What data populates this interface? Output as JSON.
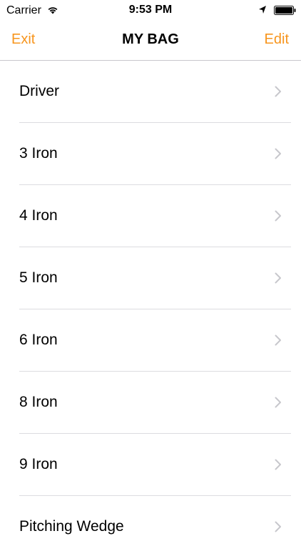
{
  "status_bar": {
    "carrier": "Carrier",
    "time": "9:53 PM",
    "icons": [
      "wifi-icon",
      "location-icon",
      "battery-icon"
    ]
  },
  "nav": {
    "left_label": "Exit",
    "title": "MY BAG",
    "right_label": "Edit",
    "accent_color": "#f7951d"
  },
  "clubs": [
    {
      "label": "Driver"
    },
    {
      "label": "3 Iron"
    },
    {
      "label": "4 Iron"
    },
    {
      "label": "5 Iron"
    },
    {
      "label": "6 Iron"
    },
    {
      "label": "8 Iron"
    },
    {
      "label": "9 Iron"
    },
    {
      "label": "Pitching Wedge"
    }
  ],
  "row_icon": "chevron-right-icon"
}
